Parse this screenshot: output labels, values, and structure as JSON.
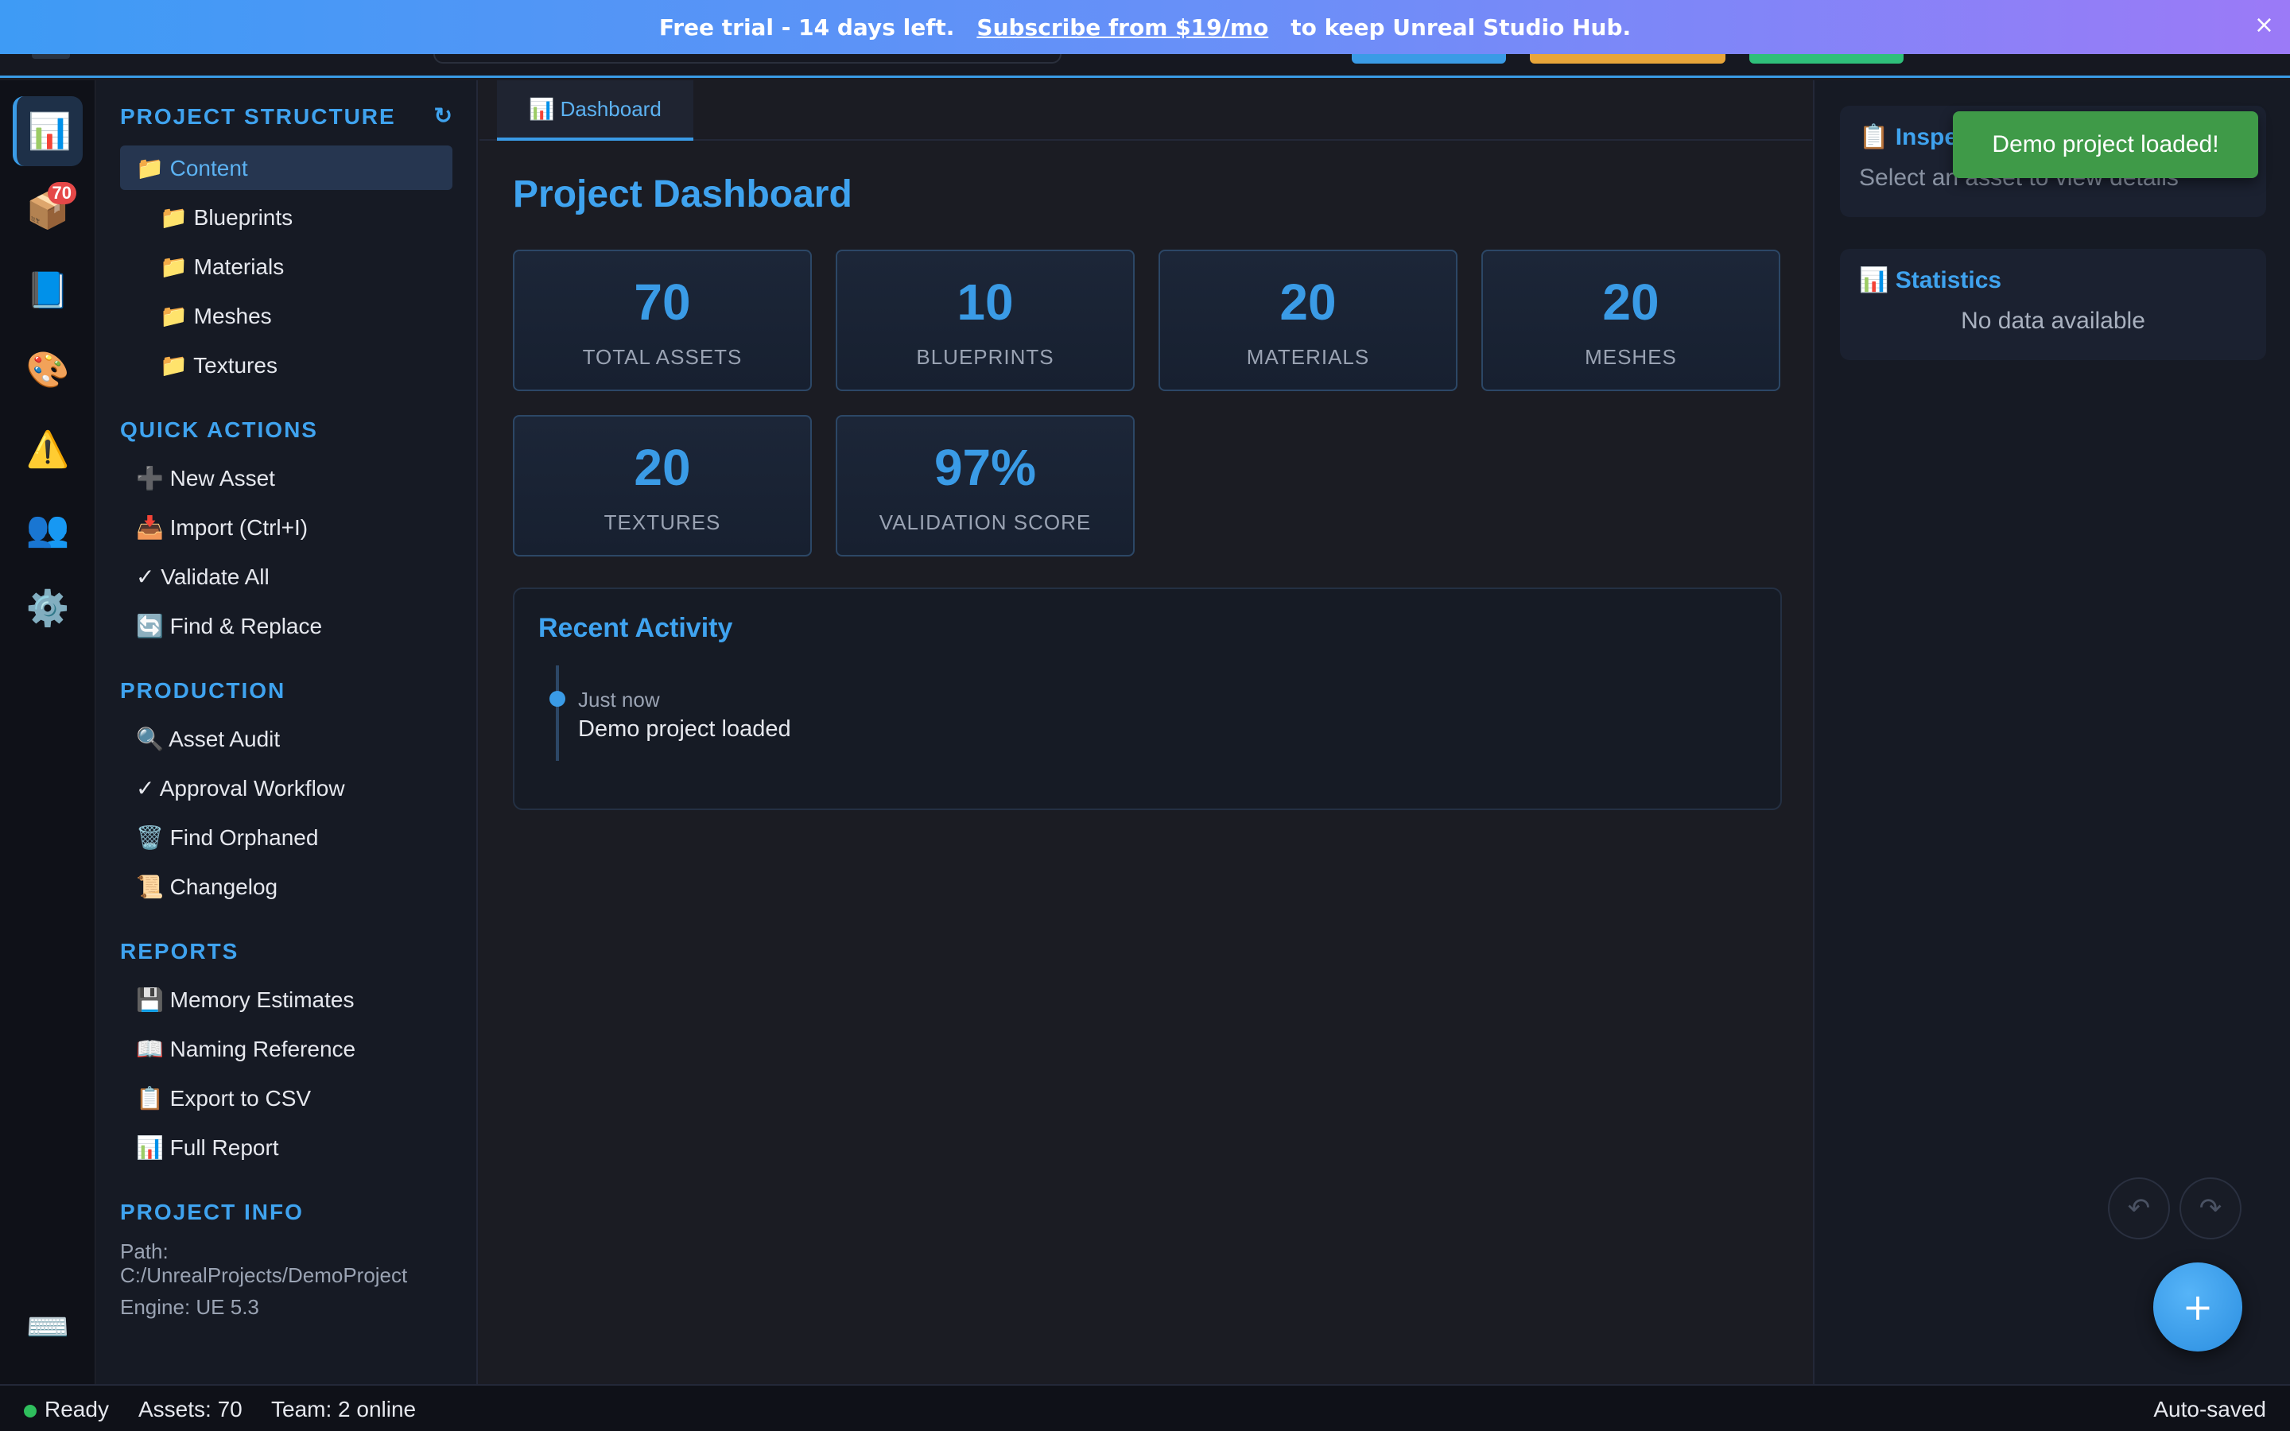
{
  "banner": {
    "text": "Free trial - 14 days left.",
    "link": "Subscribe from $19/mo",
    "suffix": "to keep Unreal Studio Hub.",
    "close": "×"
  },
  "rail": {
    "items": [
      {
        "icon": "📊",
        "name": "dashboard-icon"
      },
      {
        "icon": "📦",
        "name": "assets-icon",
        "badge": "70"
      },
      {
        "icon": "📘",
        "name": "blueprint-icon"
      },
      {
        "icon": "🎨",
        "name": "palette-icon"
      },
      {
        "icon": "⚠️",
        "name": "warning-icon"
      },
      {
        "icon": "👥",
        "name": "team-icon"
      },
      {
        "icon": "⚙️",
        "name": "gear-icon"
      }
    ],
    "keyboard": "⌨️"
  },
  "sidebar": {
    "structure_title": "PROJECT STRUCTURE",
    "refresh": "↻",
    "tree": [
      "📁 Content",
      "📁 Blueprints",
      "📁 Materials",
      "📁 Meshes",
      "📁 Textures"
    ],
    "quick_title": "QUICK ACTIONS",
    "quick": [
      "➕ New Asset",
      "📥 Import (Ctrl+I)",
      "✓ Validate All",
      "🔄 Find & Replace"
    ],
    "production_title": "PRODUCTION",
    "production": [
      "🔍 Asset Audit",
      "✓ Approval Workflow",
      "🗑️ Find Orphaned",
      "📜 Changelog"
    ],
    "reports_title": "REPORTS",
    "reports": [
      "💾 Memory Estimates",
      "📖 Naming Reference",
      "📋 Export to CSV",
      "📊 Full Report"
    ],
    "info_title": "PROJECT INFO",
    "path_label": "Path:",
    "path_value": "C:/UnrealProjects/DemoProject",
    "engine": "Engine: UE 5.3"
  },
  "main": {
    "tab": "📊 Dashboard",
    "title": "Project Dashboard",
    "stats": [
      {
        "value": "70",
        "label": "TOTAL ASSETS"
      },
      {
        "value": "10",
        "label": "BLUEPRINTS"
      },
      {
        "value": "20",
        "label": "MATERIALS"
      },
      {
        "value": "20",
        "label": "MESHES"
      },
      {
        "value": "20",
        "label": "TEXTURES"
      },
      {
        "value": "97%",
        "label": "VALIDATION SCORE"
      }
    ],
    "activity_title": "Recent Activity",
    "activity": [
      {
        "time": "Just now",
        "text": "Demo project loaded"
      }
    ]
  },
  "right": {
    "inspector_title": "📋 Inspector",
    "inspector_empty": "Select an asset to view details",
    "stats_title": "📊 Statistics",
    "stats_empty": "No data available"
  },
  "toast": "Demo project loaded!",
  "controls": {
    "undo": "↶",
    "redo": "↷",
    "fab": "+"
  },
  "status": {
    "ready": "Ready",
    "assets": "Assets: 70",
    "team": "Team: 2 online",
    "saved": "Auto-saved"
  },
  "colors": {
    "accent": "#3a9be6",
    "success": "#3f9a48",
    "badge": "#e54848"
  }
}
